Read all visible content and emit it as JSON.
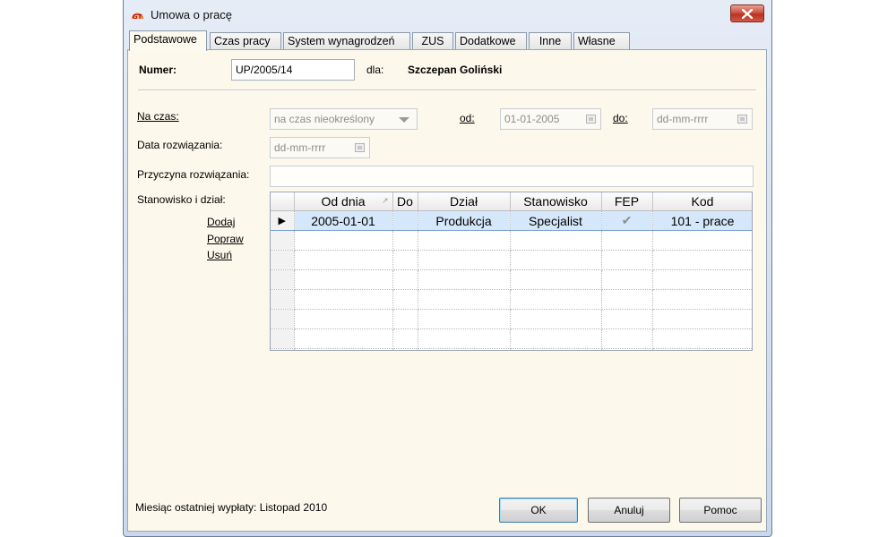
{
  "window": {
    "title": "Umowa o pracę",
    "icon": "gt-app-icon",
    "close_icon": "close-icon"
  },
  "tabs": [
    {
      "label": "Podstawowe",
      "active": true
    },
    {
      "label": "Czas pracy"
    },
    {
      "label": "System wynagrodzeń"
    },
    {
      "label": "ZUS"
    },
    {
      "label": "Dodatkowe"
    },
    {
      "label": "Inne"
    },
    {
      "label": "Własne"
    }
  ],
  "form": {
    "numer_label": "Numer:",
    "numer_value": "UP/2005/14",
    "dla_label": "dla:",
    "employee_name": "Szczepan Goliński",
    "na_czas_label": "Na czas:",
    "na_czas_value": "na czas nieokreślony",
    "od_label": "od:",
    "od_value": "01-01-2005",
    "do_label": "do:",
    "do_placeholder": "dd-mm-rrrr",
    "data_rozwiazania_label": "Data rozwiązania:",
    "data_rozwiazania_placeholder": "dd-mm-rrrr",
    "przyczyna_label": "Przyczyna rozwiązania:",
    "przyczyna_value": "",
    "stanowisko_label": "Stanowisko i dział:"
  },
  "actions": {
    "add": "Dodaj",
    "edit": "Popraw",
    "delete": "Usuń"
  },
  "table": {
    "columns": [
      "Od dnia",
      "Do",
      "Dział",
      "Stanowisko",
      "FEP",
      "Kod"
    ],
    "sort_indicator": "↗",
    "rows": [
      {
        "od_dnia": "2005-01-01",
        "do": "",
        "dzial": "Produkcja",
        "stanowisko": "Specjalist",
        "fep": "✔",
        "kod": "101 - prace"
      }
    ],
    "row_marker": "▶"
  },
  "footer": {
    "status": "Miesiąc ostatniej wypłaty: Listopad 2010",
    "ok": "OK",
    "cancel": "Anuluj",
    "help": "Pomoc"
  },
  "colors": {
    "panel": "#fcf8eb",
    "selected_row": "#d5e8fb",
    "titlebar": "#dbe5f2",
    "close": "#c9463a"
  }
}
